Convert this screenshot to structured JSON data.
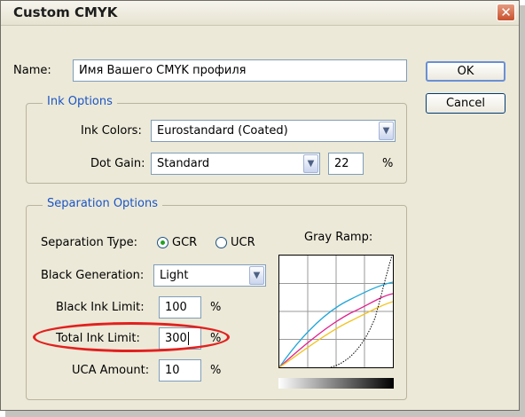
{
  "window": {
    "title": "Custom CMYK",
    "close_icon": "close-icon"
  },
  "name": {
    "label": "Name:",
    "value": "Имя Вашего CMYK профиля"
  },
  "buttons": {
    "ok": "OK",
    "cancel": "Cancel"
  },
  "ink_options": {
    "legend": "Ink Options",
    "ink_colors_label": "Ink Colors:",
    "ink_colors_value": "Eurostandard (Coated)",
    "dot_gain_label": "Dot Gain:",
    "dot_gain_value": "Standard",
    "dot_gain_amount": "22",
    "percent": "%"
  },
  "separation": {
    "legend": "Separation Options",
    "type_label": "Separation Type:",
    "gcr_label": "GCR",
    "ucr_label": "UCR",
    "selected_type": "GCR",
    "black_gen_label": "Black Generation:",
    "black_gen_value": "Light",
    "black_ink_label": "Black Ink Limit:",
    "black_ink_value": "100",
    "total_ink_label": "Total Ink Limit:",
    "total_ink_value": "300",
    "uca_label": "UCA Amount:",
    "uca_value": "10",
    "percent": "%",
    "gray_ramp_label": "Gray Ramp:"
  },
  "colors": {
    "cyan": "#1ea6d9",
    "magenta": "#e0208c",
    "yellow": "#f2c21e",
    "black": "#000000",
    "highlight": "#e2201e"
  }
}
